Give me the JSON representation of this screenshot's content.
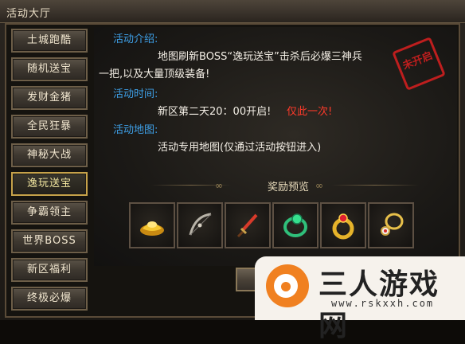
{
  "window": {
    "title": "活动大厅"
  },
  "sidebar": {
    "items": [
      {
        "label": "土城跑酷",
        "active": false
      },
      {
        "label": "随机送宝",
        "active": false
      },
      {
        "label": "发财金猪",
        "active": false
      },
      {
        "label": "全民狂暴",
        "active": false
      },
      {
        "label": "神秘大战",
        "active": false
      },
      {
        "label": "逸玩送宝",
        "active": true
      },
      {
        "label": "争霸领主",
        "active": false
      },
      {
        "label": "世界BOSS",
        "active": false
      },
      {
        "label": "新区福利",
        "active": false
      },
      {
        "label": "终极必爆",
        "active": false
      }
    ]
  },
  "event": {
    "intro_label": "活动介绍:",
    "intro_line1": "地图刷新BOSS“逸玩送宝”击杀后必爆三神兵",
    "intro_line2": "一把,以及大量顶级装备!",
    "time_label": "活动时间:",
    "time_text": "新区第二天20：00开启!",
    "time_note": "仅此一次!",
    "map_label": "活动地图:",
    "map_text": "活动专用地图(仅通过活动按钮进入)",
    "status_stamp": "未开启"
  },
  "rewards": {
    "title": "奖励预览",
    "items": [
      {
        "icon": "gold-ingot-icon"
      },
      {
        "icon": "bow-icon"
      },
      {
        "icon": "sword-icon"
      },
      {
        "icon": "green-ring-icon"
      },
      {
        "icon": "gold-ring-icon"
      },
      {
        "icon": "necklace-icon"
      }
    ]
  },
  "actions": {
    "join_label": "参加"
  },
  "watermark": {
    "name": "三人游戏网",
    "url": "www.rskxxh.com"
  },
  "colors": {
    "accent_blue": "#3ea0e8",
    "alert_red": "#ff3a2a",
    "active_border": "#c6a24a"
  }
}
